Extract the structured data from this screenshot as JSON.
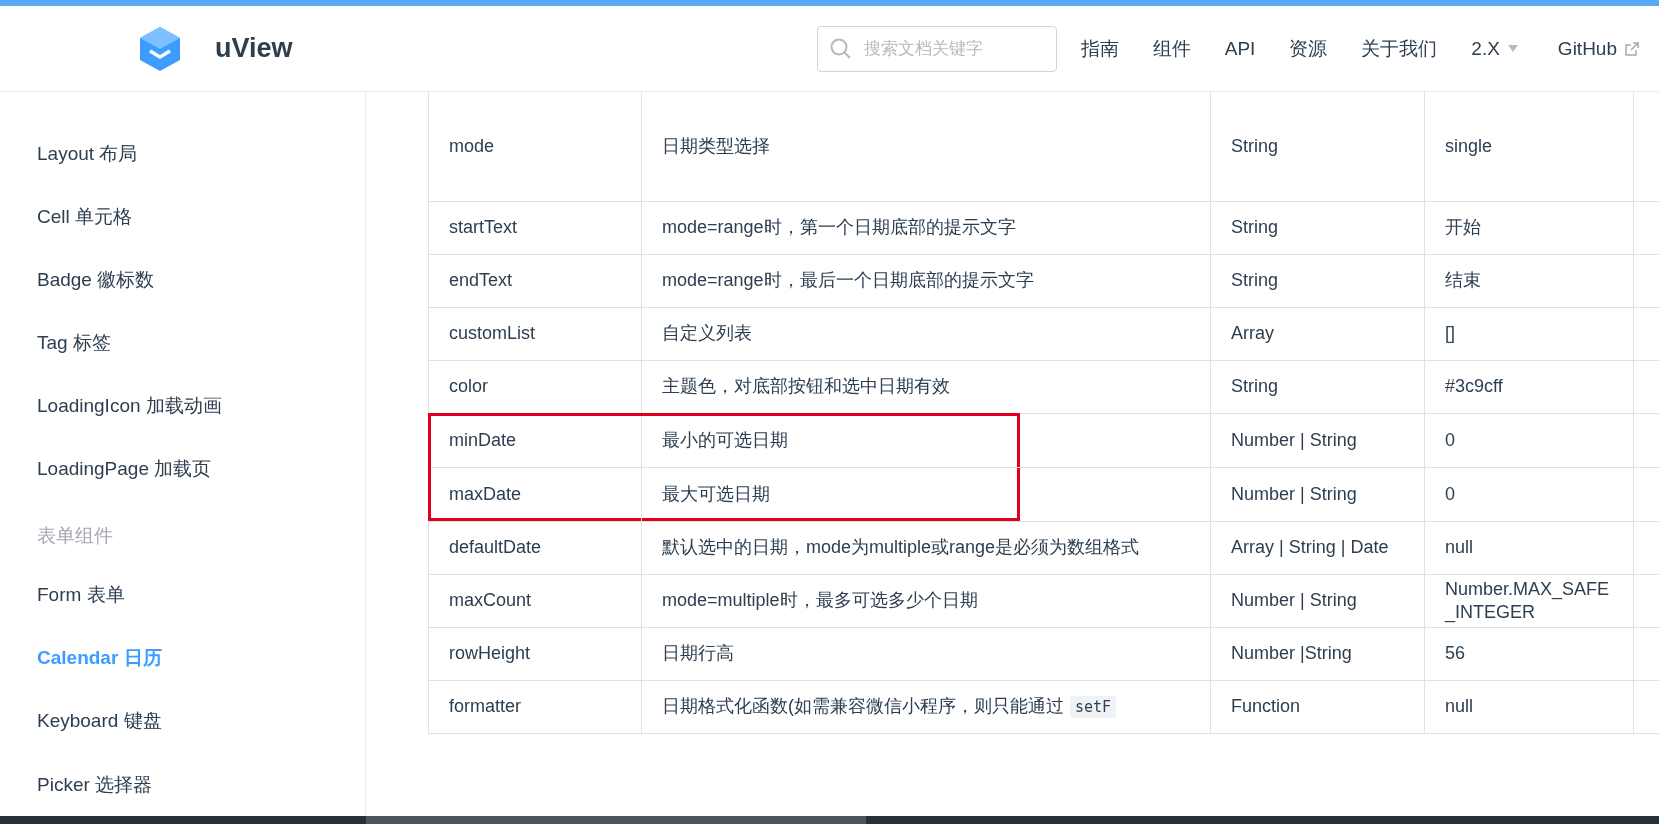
{
  "header": {
    "brand": "uView",
    "search": {
      "placeholder": "搜索文档关键字"
    },
    "nav": [
      {
        "label": "指南",
        "kind": "link"
      },
      {
        "label": "组件",
        "kind": "link"
      },
      {
        "label": "API",
        "kind": "link"
      },
      {
        "label": "资源",
        "kind": "link"
      },
      {
        "label": "关于我们",
        "kind": "link"
      },
      {
        "label": "2.X",
        "kind": "dropdown"
      },
      {
        "label": "GitHub",
        "kind": "external"
      }
    ]
  },
  "sidebar": {
    "items": [
      {
        "label": "Layout 布局",
        "kind": "link",
        "selected": false
      },
      {
        "label": "Cell 单元格",
        "kind": "link",
        "selected": false
      },
      {
        "label": "Badge 徽标数",
        "kind": "link",
        "selected": false
      },
      {
        "label": "Tag 标签",
        "kind": "link",
        "selected": false
      },
      {
        "label": "LoadingIcon 加载动画",
        "kind": "link",
        "selected": false
      },
      {
        "label": "LoadingPage 加载页",
        "kind": "link",
        "selected": false
      },
      {
        "label": "表单组件",
        "kind": "group"
      },
      {
        "label": "Form 表单",
        "kind": "link",
        "selected": false
      },
      {
        "label": "Calendar 日历",
        "kind": "link",
        "selected": true
      },
      {
        "label": "Keyboard 键盘",
        "kind": "link",
        "selected": false
      },
      {
        "label": "Picker 选择器",
        "kind": "link",
        "selected": false
      }
    ]
  },
  "table": {
    "rows": [
      {
        "name": "mode",
        "description": "日期类型选择",
        "type": "String",
        "default": "single",
        "highlighted": false
      },
      {
        "name": "startText",
        "description": "mode=range时，第一个日期底部的提示文字",
        "type": "String",
        "default": "开始",
        "highlighted": false
      },
      {
        "name": "endText",
        "description": "mode=range时，最后一个日期底部的提示文字",
        "type": "String",
        "default": "结束",
        "highlighted": false
      },
      {
        "name": "customList",
        "description": "自定义列表",
        "type": "Array",
        "default": "[]",
        "highlighted": false
      },
      {
        "name": "color",
        "description": "主题色，对底部按钮和选中日期有效",
        "type": "String",
        "default": "#3c9cff",
        "highlighted": false
      },
      {
        "name": "minDate",
        "description": "最小的可选日期",
        "type": "Number | String",
        "default": "0",
        "highlighted": true
      },
      {
        "name": "maxDate",
        "description": "最大可选日期",
        "type": "Number | String",
        "default": "0",
        "highlighted": true
      },
      {
        "name": "defaultDate",
        "description": "默认选中的日期，mode为multiple或range是必须为数组格式",
        "type": "Array | String | Date",
        "default": "null",
        "highlighted": false
      },
      {
        "name": "maxCount",
        "description": "mode=multiple时，最多可选多少个日期",
        "type": "Number | String",
        "default": "Number.MAX_SAFE_INTEGER",
        "highlighted": false
      },
      {
        "name": "rowHeight",
        "description": "日期行高",
        "type": "Number |String",
        "default": "56",
        "highlighted": false
      },
      {
        "name": "formatter",
        "description": "日期格式化函数(如需兼容微信小程序，则只能通过",
        "code": "setF",
        "type": "Function",
        "default": "null",
        "highlighted": false
      }
    ]
  }
}
